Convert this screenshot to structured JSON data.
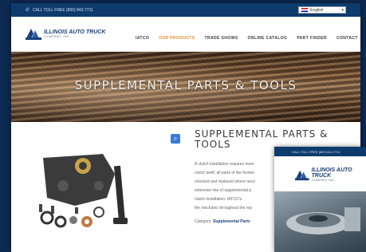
{
  "topbar": {
    "phone": "CALL TOLL FREE (800) 843-7711",
    "language": "English"
  },
  "logo": {
    "line1": "ILLINOIS AUTO TRUCK",
    "line2": "COMPANY, INC."
  },
  "nav": [
    {
      "label": "IATCO",
      "active": false
    },
    {
      "label": "OUR PRODUCTS",
      "active": true
    },
    {
      "label": "TRADE SHOWS",
      "active": false
    },
    {
      "label": "ONLINE CATALOG",
      "active": false
    },
    {
      "label": "PART FINDER",
      "active": false
    },
    {
      "label": "CONTACT",
      "active": false
    }
  ],
  "hero": {
    "title": "SUPPLEMENTAL PARTS & TOOLS"
  },
  "product": {
    "title": "SUPPLEMENTAL PARTS & TOOLS",
    "description_lines": [
      "A clutch installation requires more",
      "clutch itself; all parts of the friction",
      "checked and replaced where nece",
      "extensive line of supplemental p",
      "clutch installation. IATCO's",
      "the mechanic throughout the rep"
    ],
    "category_label": "Category:",
    "category_value": "Supplemental Parts"
  },
  "overlay": {
    "phone": "CALL TOLL FREE (800) 843-7711",
    "logo_line1": "ILLINOIS AUTO TRUCK",
    "logo_line2": "COMPANY, INC."
  },
  "colors": {
    "background": "#0d2a52",
    "topbar": "#0e3b6d",
    "accent": "#e58a2a",
    "brand": "#1a3f7a"
  }
}
